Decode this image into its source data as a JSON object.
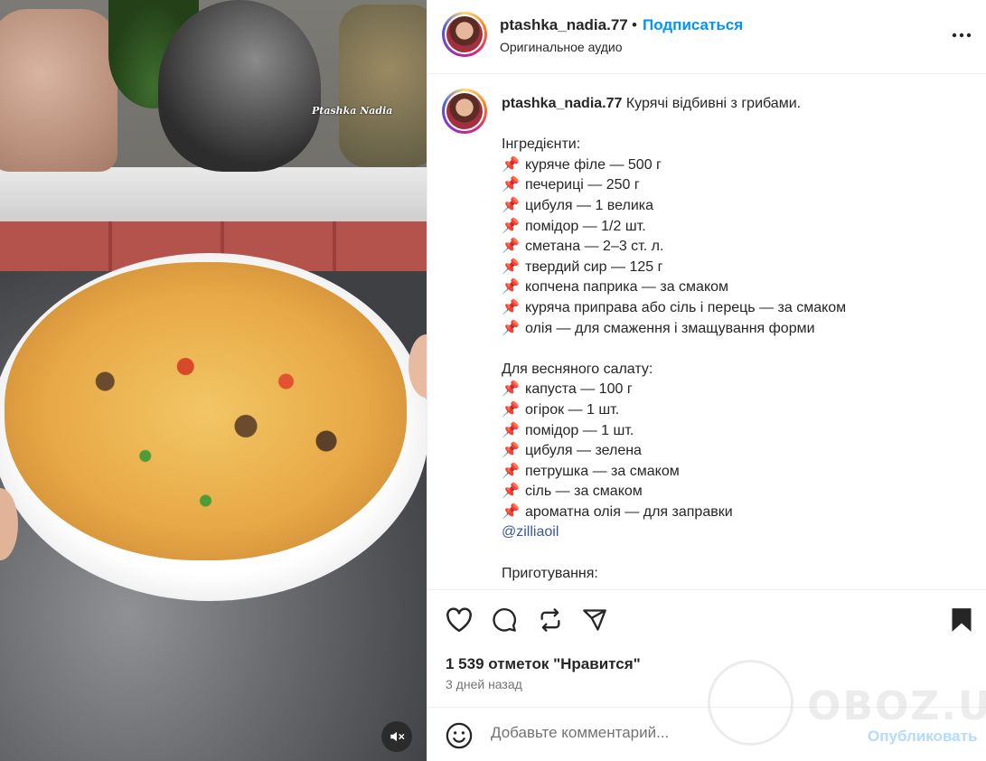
{
  "media": {
    "watermark": "Ptashka Nadia",
    "mute_icon": "speaker-muted-icon"
  },
  "header": {
    "username": "ptashka_nadia.77",
    "separator": "•",
    "follow_label": "Подписаться",
    "audio_label": "Оригинальное аудио",
    "more_icon": "more-horizontal-icon"
  },
  "caption": {
    "username": "ptashka_nadia.77",
    "title": "Курячі відбивні з грибами.",
    "ingredients_heading": "Інгредієнти:",
    "ingredients": [
      "куряче філе — 500 г",
      "печериці — 250 г",
      "цибуля — 1 велика",
      "помідор — 1/2 шт.",
      "сметана — 2–3 ст. л.",
      "твердий сир — 125 г",
      "копчена паприка — за смаком",
      "куряча приправа або сіль і перець — за смаком",
      "олія — для смаження і змащування форми"
    ],
    "salad_heading": "Для весняного салату:",
    "salad": [
      "капуста — 100 г",
      "огірок — 1 шт.",
      "помідор — 1 шт.",
      "цибуля — зелена",
      "петрушка — за смаком",
      "сіль — за смаком",
      "ароматна олія — для заправки"
    ],
    "pin_icon": "📌",
    "mention": "@zilliaoil",
    "preparation_heading": "Приготування:"
  },
  "actions": {
    "icons": [
      "heart-icon",
      "comment-icon",
      "repost-icon",
      "share-icon",
      "bookmark-icon"
    ],
    "likes": "1 539 отметок \"Нравится\"",
    "time": "3 дней назад"
  },
  "comment": {
    "placeholder": "Добавьте комментарий...",
    "publish_label": "Опубликовать"
  },
  "brand_watermark": {
    "text": "OBOZ.UA"
  },
  "colors": {
    "accent": "#0095f6",
    "publish_disabled": "#b3dbff",
    "pin": "#d0213c",
    "mention": "#385898"
  }
}
